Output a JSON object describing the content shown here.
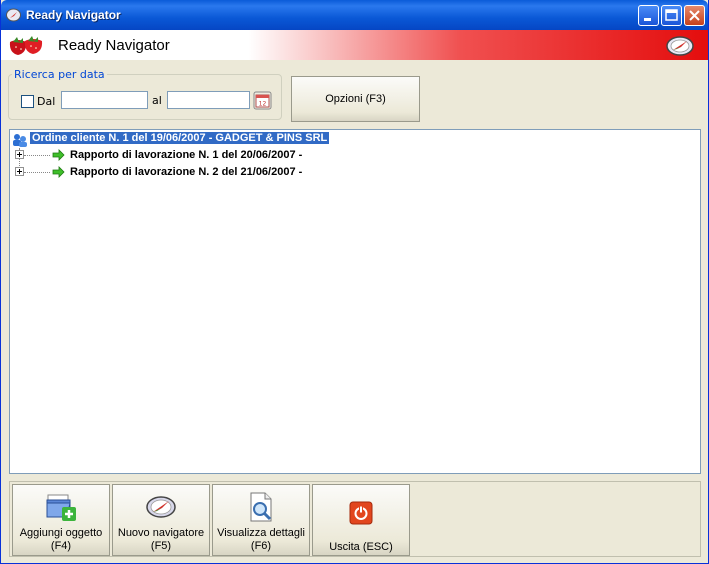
{
  "window": {
    "title": "Ready Navigator",
    "header_title": "Ready Navigator"
  },
  "search": {
    "group_label": "Ricerca per data",
    "from_label": "Dal",
    "from_checked": false,
    "from_value": "",
    "to_label": "al",
    "to_value": ""
  },
  "toolbar": {
    "options_label": "Opzioni (F3)"
  },
  "tree": {
    "root": {
      "label": "Ordine cliente N. 1 del 19/06/2007 - GADGET & PINS SRL",
      "selected": true,
      "icon": "customer-order-icon"
    },
    "children": [
      {
        "label": "Rapporto di lavorazione N. 1 del 20/06/2007 -",
        "icon": "green-arrow-icon"
      },
      {
        "label": "Rapporto di lavorazione N. 2 del 21/06/2007 -",
        "icon": "green-arrow-icon"
      }
    ]
  },
  "actions": [
    {
      "line1": "Aggiungi oggetto",
      "line2": "(F4)",
      "icon": "add-object-icon"
    },
    {
      "line1": "Nuovo navigatore",
      "line2": "(F5)",
      "icon": "compass-icon"
    },
    {
      "line1": "Visualizza dettagli",
      "line2": "(F6)",
      "icon": "view-details-icon"
    },
    {
      "line1": "Uscita (ESC)",
      "line2": "",
      "icon": "exit-icon"
    }
  ],
  "colors": {
    "selection": "#316ac5",
    "titlebar": "#0a58d6",
    "header_red": "#e40d0d",
    "legend_blue": "#0046d5"
  }
}
